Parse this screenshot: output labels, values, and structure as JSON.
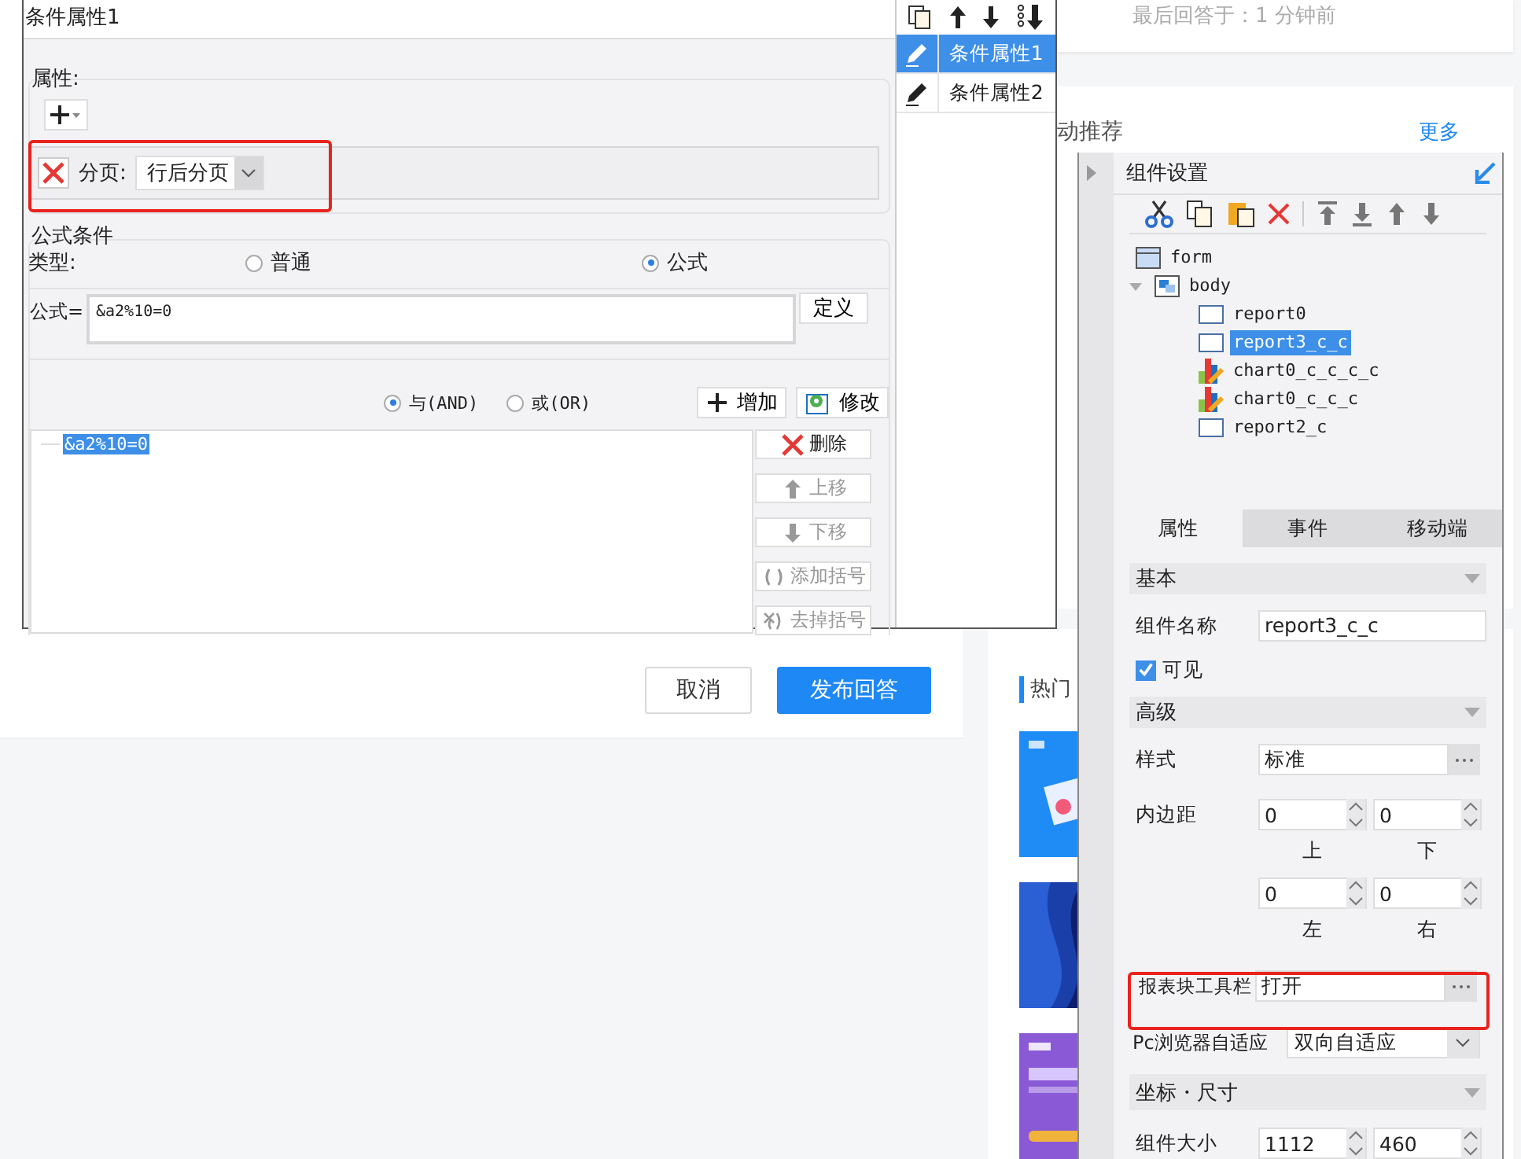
{
  "background_page": {
    "last_answer": "最后回答于：1 分钟前",
    "recommend_title": "动推荐",
    "more_link": "更多",
    "cancel_button": "取消",
    "publish_button": "发布回答",
    "hot_title": "热门"
  },
  "dialog": {
    "title": "条件属性1",
    "attributes_label": "属性:",
    "attribute_rows": [
      {
        "label": "分页:",
        "value": "行后分页"
      }
    ],
    "formula_section": "公式条件",
    "type_label": "类型:",
    "type_options": [
      {
        "label": "普通",
        "selected": false
      },
      {
        "label": "公式",
        "selected": true
      }
    ],
    "formula_label": "公式=",
    "formula_value": "&a2%10=0",
    "define_button": "定义",
    "logic_options": [
      {
        "label": "与(AND)",
        "selected": true
      },
      {
        "label": "或(OR)",
        "selected": false
      }
    ],
    "add_button": "增加",
    "modify_button": "修改",
    "conditions": [
      {
        "text": "&a2%10=0",
        "selected": true
      }
    ],
    "side_buttons": [
      {
        "label": "删除",
        "kind": "delete",
        "disabled": false
      },
      {
        "label": "上移",
        "kind": "up",
        "disabled": true
      },
      {
        "label": "下移",
        "kind": "down",
        "disabled": true
      },
      {
        "label": "添加括号",
        "kind": "paren",
        "disabled": true
      },
      {
        "label": "去掉括号",
        "kind": "unparen",
        "disabled": true
      }
    ]
  },
  "condition_list": [
    {
      "label": "条件属性1",
      "selected": true
    },
    {
      "label": "条件属性2",
      "selected": false
    }
  ],
  "component_panel": {
    "title": "组件设置",
    "tree": [
      {
        "label": "form",
        "kind": "form",
        "children": [
          {
            "label": "body",
            "kind": "body",
            "expanded": true,
            "children": [
              {
                "label": "report0",
                "kind": "report",
                "selected": false
              },
              {
                "label": "report3_c_c",
                "kind": "report",
                "selected": true
              },
              {
                "label": "chart0_c_c_c_c",
                "kind": "chart",
                "selected": false
              },
              {
                "label": "chart0_c_c_c",
                "kind": "chart",
                "selected": false
              },
              {
                "label": "report2_c",
                "kind": "report",
                "selected": false
              }
            ]
          }
        ]
      }
    ],
    "tabs": [
      {
        "label": "属性",
        "selected": true
      },
      {
        "label": "事件",
        "selected": false
      },
      {
        "label": "移动端",
        "selected": false
      }
    ],
    "basic": {
      "title": "基本",
      "name_label": "组件名称",
      "name_value": "report3_c_c",
      "visible_label": "可见",
      "visible_checked": true
    },
    "advanced": {
      "title": "高级",
      "style_label": "样式",
      "style_value": "标准",
      "padding_label": "内边距",
      "paddings": [
        {
          "value": "0",
          "caption": "上"
        },
        {
          "value": "0",
          "caption": "下"
        },
        {
          "value": "0",
          "caption": "左"
        },
        {
          "value": "0",
          "caption": "右"
        }
      ],
      "toolbar_label": "报表块工具栏",
      "toolbar_value": "打开",
      "adapt_label": "Pc浏览器自适应",
      "adapt_value": "双向自适应"
    },
    "position": {
      "title": "坐标・尺寸",
      "size_label": "组件大小",
      "sizes": [
        "1112",
        "460"
      ]
    }
  }
}
